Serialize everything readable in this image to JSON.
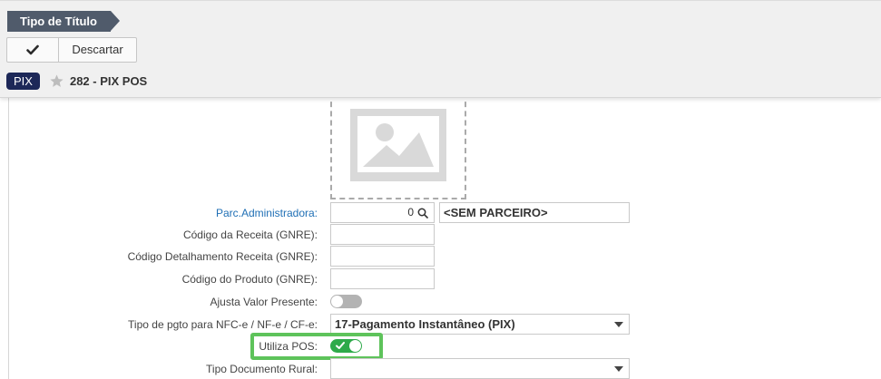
{
  "header": {
    "breadcrumb": "Tipo de Título",
    "toolbar": {
      "discard_label": "Descartar"
    },
    "record": {
      "badge": "PIX",
      "title": "282 - PIX POS"
    }
  },
  "form": {
    "parc_admin": {
      "label": "Parc.Administradora:",
      "value": "0",
      "partner_name": "<SEM PARCEIRO>"
    },
    "codigo_receita": {
      "label": "Código da Receita (GNRE):",
      "value": ""
    },
    "codigo_detalhamento": {
      "label": "Código Detalhamento Receita (GNRE):",
      "value": ""
    },
    "codigo_produto": {
      "label": "Código do Produto (GNRE):",
      "value": ""
    },
    "ajusta_valor": {
      "label": "Ajusta Valor Presente:",
      "checked": false
    },
    "tipo_pgto": {
      "label": "Tipo de pgto para NFC-e / NF-e / CF-e:",
      "value": "17-Pagamento Instantâneo (PIX)"
    },
    "utiliza_pos": {
      "label": "Utiliza POS:",
      "checked": true
    },
    "tipo_doc_rural": {
      "label": "Tipo Documento Rural:",
      "value": ""
    }
  },
  "colors": {
    "accent_green": "#2eaa4a",
    "highlight": "#5ec35b",
    "badge": "#1d2858",
    "breadcrumb": "#505b6b",
    "link": "#1f6fb5"
  }
}
